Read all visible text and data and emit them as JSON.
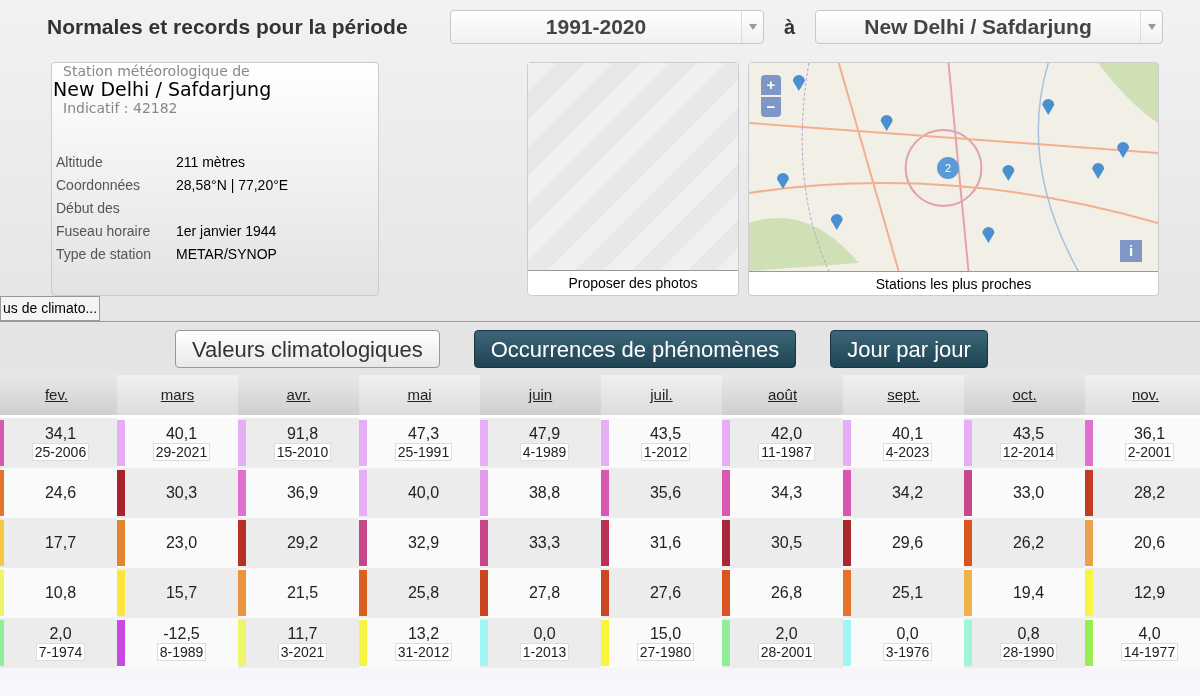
{
  "header": {
    "title": "Normales et records pour la période",
    "period_select": {
      "value": "1991-2020"
    },
    "connector": "à",
    "station_select": {
      "value": "New Delhi / Safdarjung"
    }
  },
  "station": {
    "caption": "Station météorologique de",
    "name": "New Delhi / Safdarjung",
    "code": "Indicatif : 42182",
    "details": [
      {
        "label": "Altitude",
        "value": "211 mètres"
      },
      {
        "label": "Coordonnées",
        "value": "28,58°N | 77,20°E"
      },
      {
        "label": "Début des"
      },
      {
        "label": "Fuseau horaire",
        "value": "1er janvier 1944"
      },
      {
        "label": "Type de station",
        "value": "METAR/SYNOP"
      }
    ]
  },
  "photos": {
    "caption": "Proposer des photos"
  },
  "map": {
    "kind": "picture",
    "zoom_in": "+",
    "zoom_out": "−",
    "cluster": "2",
    "info": "i",
    "caption": "Stations les plus proches"
  },
  "side_tab": "us de climato...",
  "views": [
    {
      "label": "Valeurs climatologiques",
      "selected": true
    },
    {
      "label": "Occurrences de phénomènes",
      "selected": false
    },
    {
      "label": "Jour par jour",
      "selected": false
    }
  ],
  "table": {
    "columns": [
      "fev.",
      "mars",
      "avr.",
      "mai",
      "juin",
      "juil.",
      "août",
      "sept.",
      "oct.",
      "nov."
    ],
    "rows": [
      {
        "cells": [
          {
            "value": "34,1",
            "date": "25-2006",
            "color": "#d957b0"
          },
          {
            "value": "40,1",
            "date": "29-2021",
            "color": "#e8aef5"
          },
          {
            "value": "91,8",
            "date": "15-2010",
            "color": "#e8aef5"
          },
          {
            "value": "47,3",
            "date": "25-1991",
            "color": "#e8aef5"
          },
          {
            "value": "47,9",
            "date": "4-1989",
            "color": "#e8aef5"
          },
          {
            "value": "43,5",
            "date": "1-2012",
            "color": "#e8aef5"
          },
          {
            "value": "42,0",
            "date": "11-1987",
            "color": "#e8aef5"
          },
          {
            "value": "40,1",
            "date": "4-2023",
            "color": "#e8aef5"
          },
          {
            "value": "43,5",
            "date": "12-2014",
            "color": "#e8aef5"
          },
          {
            "value": "36,1",
            "date": "2-2001",
            "color": "#e070d0"
          }
        ]
      },
      {
        "cells": [
          {
            "value": "24,6",
            "color": "#e5732a"
          },
          {
            "value": "30,3",
            "color": "#a8222c"
          },
          {
            "value": "36,9",
            "color": "#e070d0"
          },
          {
            "value": "40,0",
            "color": "#e8aef5"
          },
          {
            "value": "38,8",
            "color": "#e39ae8"
          },
          {
            "value": "35,6",
            "color": "#d957b0"
          },
          {
            "value": "34,3",
            "color": "#d957b0"
          },
          {
            "value": "34,2",
            "color": "#d957b0"
          },
          {
            "value": "33,0",
            "color": "#c8478a"
          },
          {
            "value": "28,2",
            "color": "#c23b22"
          }
        ]
      },
      {
        "cells": [
          {
            "value": "17,7",
            "color": "#f5c842"
          },
          {
            "value": "23,0",
            "color": "#e5832f"
          },
          {
            "value": "29,2",
            "color": "#b52f24"
          },
          {
            "value": "32,9",
            "color": "#c8478a"
          },
          {
            "value": "33,3",
            "color": "#c8478a"
          },
          {
            "value": "31,6",
            "color": "#b83256"
          },
          {
            "value": "30,5",
            "color": "#a8283a"
          },
          {
            "value": "29,6",
            "color": "#a8282a"
          },
          {
            "value": "26,2",
            "color": "#d9551f"
          },
          {
            "value": "20,6",
            "color": "#eda04a"
          }
        ]
      },
      {
        "cells": [
          {
            "value": "10,8",
            "color": "#eef56a"
          },
          {
            "value": "15,7",
            "color": "#fbe63a"
          },
          {
            "value": "21,5",
            "color": "#ea9440"
          },
          {
            "value": "25,8",
            "color": "#d9601f"
          },
          {
            "value": "27,8",
            "color": "#c9461f"
          },
          {
            "value": "27,6",
            "color": "#c9461f"
          },
          {
            "value": "26,8",
            "color": "#d9551f"
          },
          {
            "value": "25,1",
            "color": "#e5732a"
          },
          {
            "value": "19,4",
            "color": "#f0b04a"
          },
          {
            "value": "12,9",
            "color": "#f5f542"
          }
        ]
      },
      {
        "cells": [
          {
            "value": "2,0",
            "date": "7-1974",
            "color": "#90ee98"
          },
          {
            "value": "-12,5",
            "date": "8-1989",
            "color": "#c84ae0"
          },
          {
            "value": "11,7",
            "date": "3-2021",
            "color": "#eef56a"
          },
          {
            "value": "13,2",
            "date": "31-2012",
            "color": "#f5f542"
          },
          {
            "value": "0,0",
            "date": "1-2013",
            "color": "#a0f5f5"
          },
          {
            "value": "15,0",
            "date": "27-1980",
            "color": "#fbf53a"
          },
          {
            "value": "2,0",
            "date": "28-2001",
            "color": "#90ee98"
          },
          {
            "value": "0,0",
            "date": "3-1976",
            "color": "#a0f5f5"
          },
          {
            "value": "0,8",
            "date": "28-1990",
            "color": "#a0f5d5"
          },
          {
            "value": "4,0",
            "date": "14-1977",
            "color": "#98ee50"
          }
        ]
      }
    ]
  }
}
